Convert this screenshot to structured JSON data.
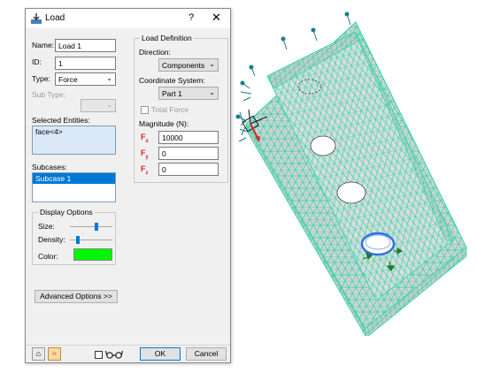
{
  "dialog": {
    "title": "Load",
    "help_glyph": "?",
    "close_glyph": "✕"
  },
  "left": {
    "name_label": "Name:",
    "name_value": "Load 1",
    "id_label": "ID:",
    "id_value": "1",
    "type_label": "Type:",
    "type_value": "Force",
    "subtype_label": "Sub Type:",
    "subtype_value": "",
    "selected_entities_label": "Selected Entities:",
    "selected_entities": [
      "face<4>"
    ],
    "subcases_label": "Subcases:",
    "subcases": [
      "Subcase 1"
    ]
  },
  "display_options": {
    "title": "Display Options",
    "size_label": "Size:",
    "size_level": 0.6,
    "density_label": "Density:",
    "density_level": 0.15,
    "color_label": "Color:",
    "color": "#00f700"
  },
  "load_definition": {
    "title": "Load Definition",
    "direction_label": "Direction:",
    "direction_value": "Components",
    "coordinate_system_label": "Coordinate System:",
    "coordinate_system_value": "Part 1",
    "total_force_label": "Total Force",
    "total_force_checked": false,
    "magnitude_label": "Magnitude (N):",
    "fx_symbol": "F",
    "fx_sub": "x",
    "fx_value": "10000",
    "fy_symbol": "F",
    "fy_sub": "y",
    "fy_value": "0",
    "fz_symbol": "F",
    "fz_sub": "z",
    "fz_value": "0"
  },
  "buttons": {
    "advanced": "Advanced Options >>",
    "ok": "OK",
    "cancel": "Cancel"
  },
  "bottom_bar": {
    "show_glyph": "⌂",
    "collapse_glyph": "≈"
  },
  "colors": {
    "mesh_face": "#cfd3d3",
    "mesh_line": "#2fd8a4",
    "constraint": "#1a7d86",
    "force": "#d7262e",
    "selection_blue": "#0078d7"
  }
}
